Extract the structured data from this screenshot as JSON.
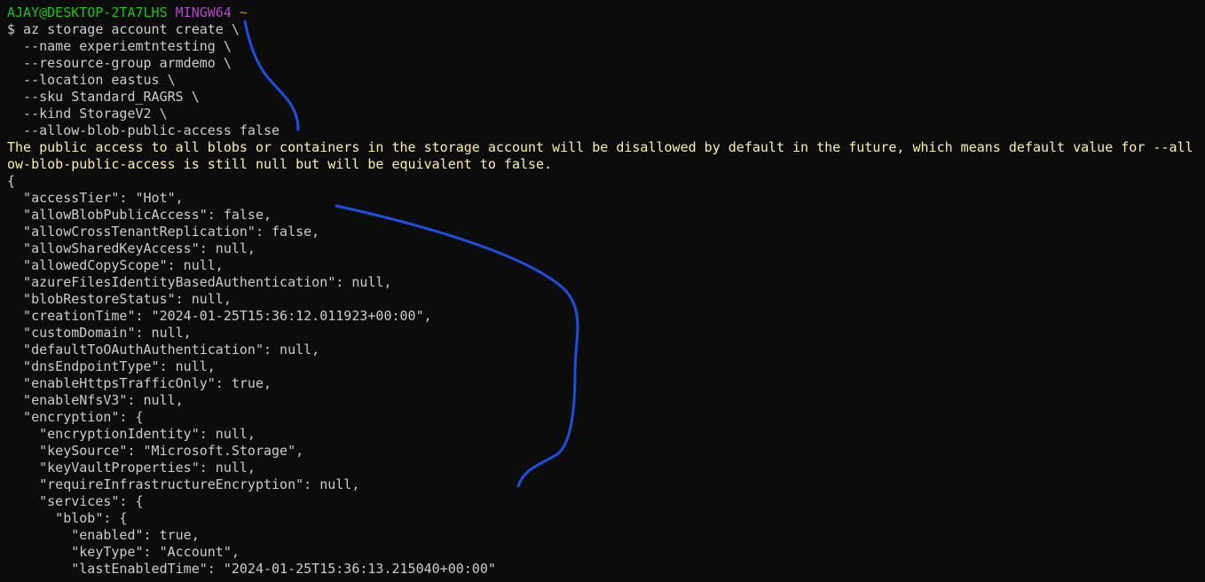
{
  "prompt": {
    "user_host": "AJAY@DESKTOP-2TA7LHS",
    "shell": "MINGW64",
    "path": "~"
  },
  "command_lines": [
    "$ az storage account create \\",
    "  --name experiemtntesting \\",
    "  --resource-group armdemo \\",
    "  --location eastus \\",
    "  --sku Standard_RAGRS \\",
    "  --kind StorageV2 \\",
    "  --allow-blob-public-access false"
  ],
  "warning_lines": [
    "The public access to all blobs or containers in the storage account will be disallowed by default in the future, which means default value for --all",
    "ow-blob-public-access is still null but will be equivalent to false."
  ],
  "output_lines": [
    "{",
    "  \"accessTier\": \"Hot\",",
    "  \"allowBlobPublicAccess\": false,",
    "  \"allowCrossTenantReplication\": false,",
    "  \"allowSharedKeyAccess\": null,",
    "  \"allowedCopyScope\": null,",
    "  \"azureFilesIdentityBasedAuthentication\": null,",
    "  \"blobRestoreStatus\": null,",
    "  \"creationTime\": \"2024-01-25T15:36:12.011923+00:00\",",
    "  \"customDomain\": null,",
    "  \"defaultToOAuthAuthentication\": null,",
    "  \"dnsEndpointType\": null,",
    "  \"enableHttpsTrafficOnly\": true,",
    "  \"enableNfsV3\": null,",
    "  \"encryption\": {",
    "    \"encryptionIdentity\": null,",
    "    \"keySource\": \"Microsoft.Storage\",",
    "    \"keyVaultProperties\": null,",
    "    \"requireInfrastructureEncryption\": null,",
    "    \"services\": {",
    "      \"blob\": {",
    "        \"enabled\": true,",
    "        \"keyType\": \"Account\",",
    "        \"lastEnabledTime\": \"2024-01-25T15:36:13.215040+00:00\""
  ],
  "colors": {
    "background": "#0c0c0c",
    "text": "#cccccc",
    "prompt_user": "#16c60c",
    "prompt_shell": "#b148c6",
    "prompt_path": "#c19c00",
    "warning": "#f9f1a5",
    "annotation": "#1a4fe0"
  }
}
